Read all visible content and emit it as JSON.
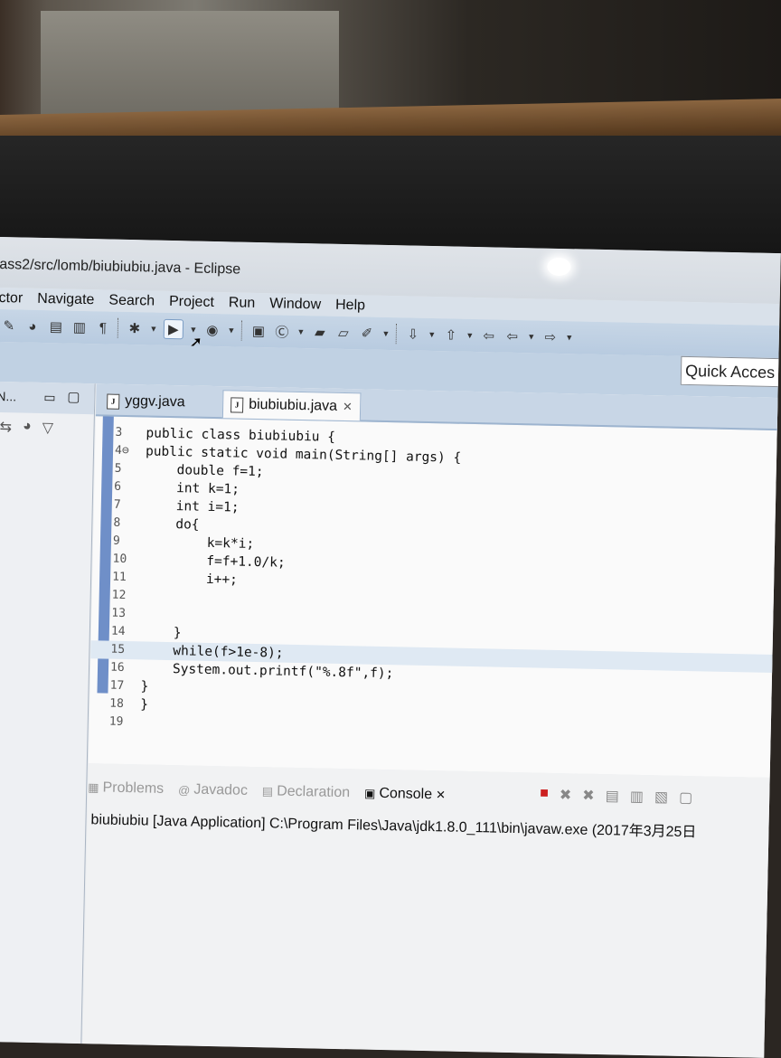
{
  "window": {
    "title": "ass2/src/lomb/biubiubiu.java - Eclipse"
  },
  "menu": [
    "ctor",
    "Navigate",
    "Search",
    "Project",
    "Run",
    "Window",
    "Help"
  ],
  "quick_access": "Quick Acces",
  "left_panel": {
    "title": "N..."
  },
  "editor": {
    "tabs": [
      {
        "label": "yggv.java"
      },
      {
        "label": "biubiubiu.java"
      }
    ],
    "lines": [
      {
        "num": "3",
        "code": "public class biubiubiu {"
      },
      {
        "num": "4⊖",
        "code": "public static void main(String[] args) {"
      },
      {
        "num": "5",
        "code": "    double f=1;"
      },
      {
        "num": "6",
        "code": "    int k=1;"
      },
      {
        "num": "7",
        "code": "    int i=1;"
      },
      {
        "num": "8",
        "code": "    do{"
      },
      {
        "num": "9",
        "code": "        k=k*i;"
      },
      {
        "num": "10",
        "code": "        f=f+1.0/k;"
      },
      {
        "num": "11",
        "code": "        i++;"
      },
      {
        "num": "12",
        "code": ""
      },
      {
        "num": "13",
        "code": ""
      },
      {
        "num": "14",
        "code": "    }"
      },
      {
        "num": "15",
        "code": "    while(f>1e-8);"
      },
      {
        "num": "16",
        "code": "    System.out.printf(\"%.8f\",f);"
      },
      {
        "num": "17",
        "code": "}"
      },
      {
        "num": "18",
        "code": "}"
      },
      {
        "num": "19",
        "code": ""
      }
    ]
  },
  "bottom": {
    "tabs": [
      "Problems",
      "Javadoc",
      "Declaration",
      "Console"
    ],
    "console_line": "biubiubiu [Java Application] C:\\Program Files\\Java\\jdk1.8.0_111\\bin\\javaw.exe (2017年3月25日"
  }
}
